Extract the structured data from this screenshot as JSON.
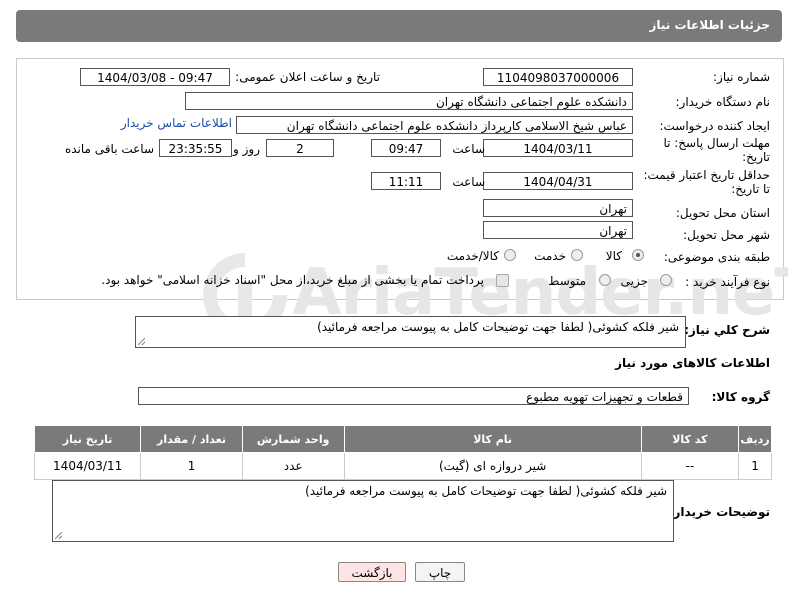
{
  "header": {
    "title": "جزئیات اطلاعات نیاز"
  },
  "watermark": {
    "text": "AriaTender.neT"
  },
  "form": {
    "need_number_label": "شماره نیاز:",
    "need_number": "1104098037000006",
    "announce_label": "تاریخ و ساعت اعلان عمومی:",
    "announce_value": "1404/03/08 - 09:47",
    "buyer_org_label": "نام دستگاه خریدار:",
    "buyer_org": "دانشکده علوم اجتماعی دانشگاه تهران",
    "creator_label": "ایجاد کننده درخواست:",
    "creator": "عباس شیخ الاسلامی کارپرداز دانشکده علوم اجتماعی دانشگاه تهران",
    "contact_link": "اطلاعات تماس خریدار",
    "deadline_label_1": "مهلت ارسال پاسخ: تا",
    "deadline_label_2": "تاریخ:",
    "deadline_date": "1404/03/11",
    "time_label": "ساعت",
    "deadline_time": "09:47",
    "days_value": "2",
    "days_label": "روز و",
    "remaining_time": "23:35:55",
    "remaining_label": "ساعت باقی مانده",
    "validity_label_1": "حداقل تاریخ اعتبار قیمت:",
    "validity_label_2": "تا تاریخ:",
    "validity_date": "1404/04/31",
    "validity_time": "11:11",
    "province_label": "استان محل تحویل:",
    "province": "تهران",
    "city_label": "شهر محل تحویل:",
    "city": "تهران",
    "category_label": "طبقه بندی موضوعی:",
    "category_options": [
      "کالا",
      "خدمت",
      "کالا/خدمت"
    ],
    "category_selected": "کالا",
    "process_label": "نوع فرآیند خرید :",
    "process_options": [
      "جزیی",
      "متوسط"
    ],
    "payment_note": "پرداخت تمام یا بخشی از مبلغ خرید،از محل \"اسناد خزانه اسلامی\" خواهد بود."
  },
  "description": {
    "label": "شرح كلي نياز:",
    "text": "شیر فلکه کشوئی( لطفا جهت توضیحات کامل به پیوست مراجعه فرمائید)"
  },
  "goods": {
    "section_title": "اطلاعات کالاهای مورد نیاز",
    "group_label": "گروه کالا:",
    "group_value": "قطعات و تجهیزات تهویه مطبوع",
    "columns": [
      "ردیف",
      "کد کالا",
      "نام کالا",
      "واحد شمارش",
      "تعداد / مقدار",
      "تاریخ نیاز"
    ],
    "rows": [
      [
        "1",
        "--",
        "شیر دروازه ای (گیت)",
        "عدد",
        "1",
        "1404/03/11"
      ]
    ]
  },
  "buyer_notes": {
    "label": "توضیحات خریدار:",
    "text": "شیر فلکه کشوئی( لطفا جهت توضیحات کامل به پیوست مراجعه فرمائید)"
  },
  "buttons": {
    "print": "چاپ",
    "back": "بازگشت"
  }
}
